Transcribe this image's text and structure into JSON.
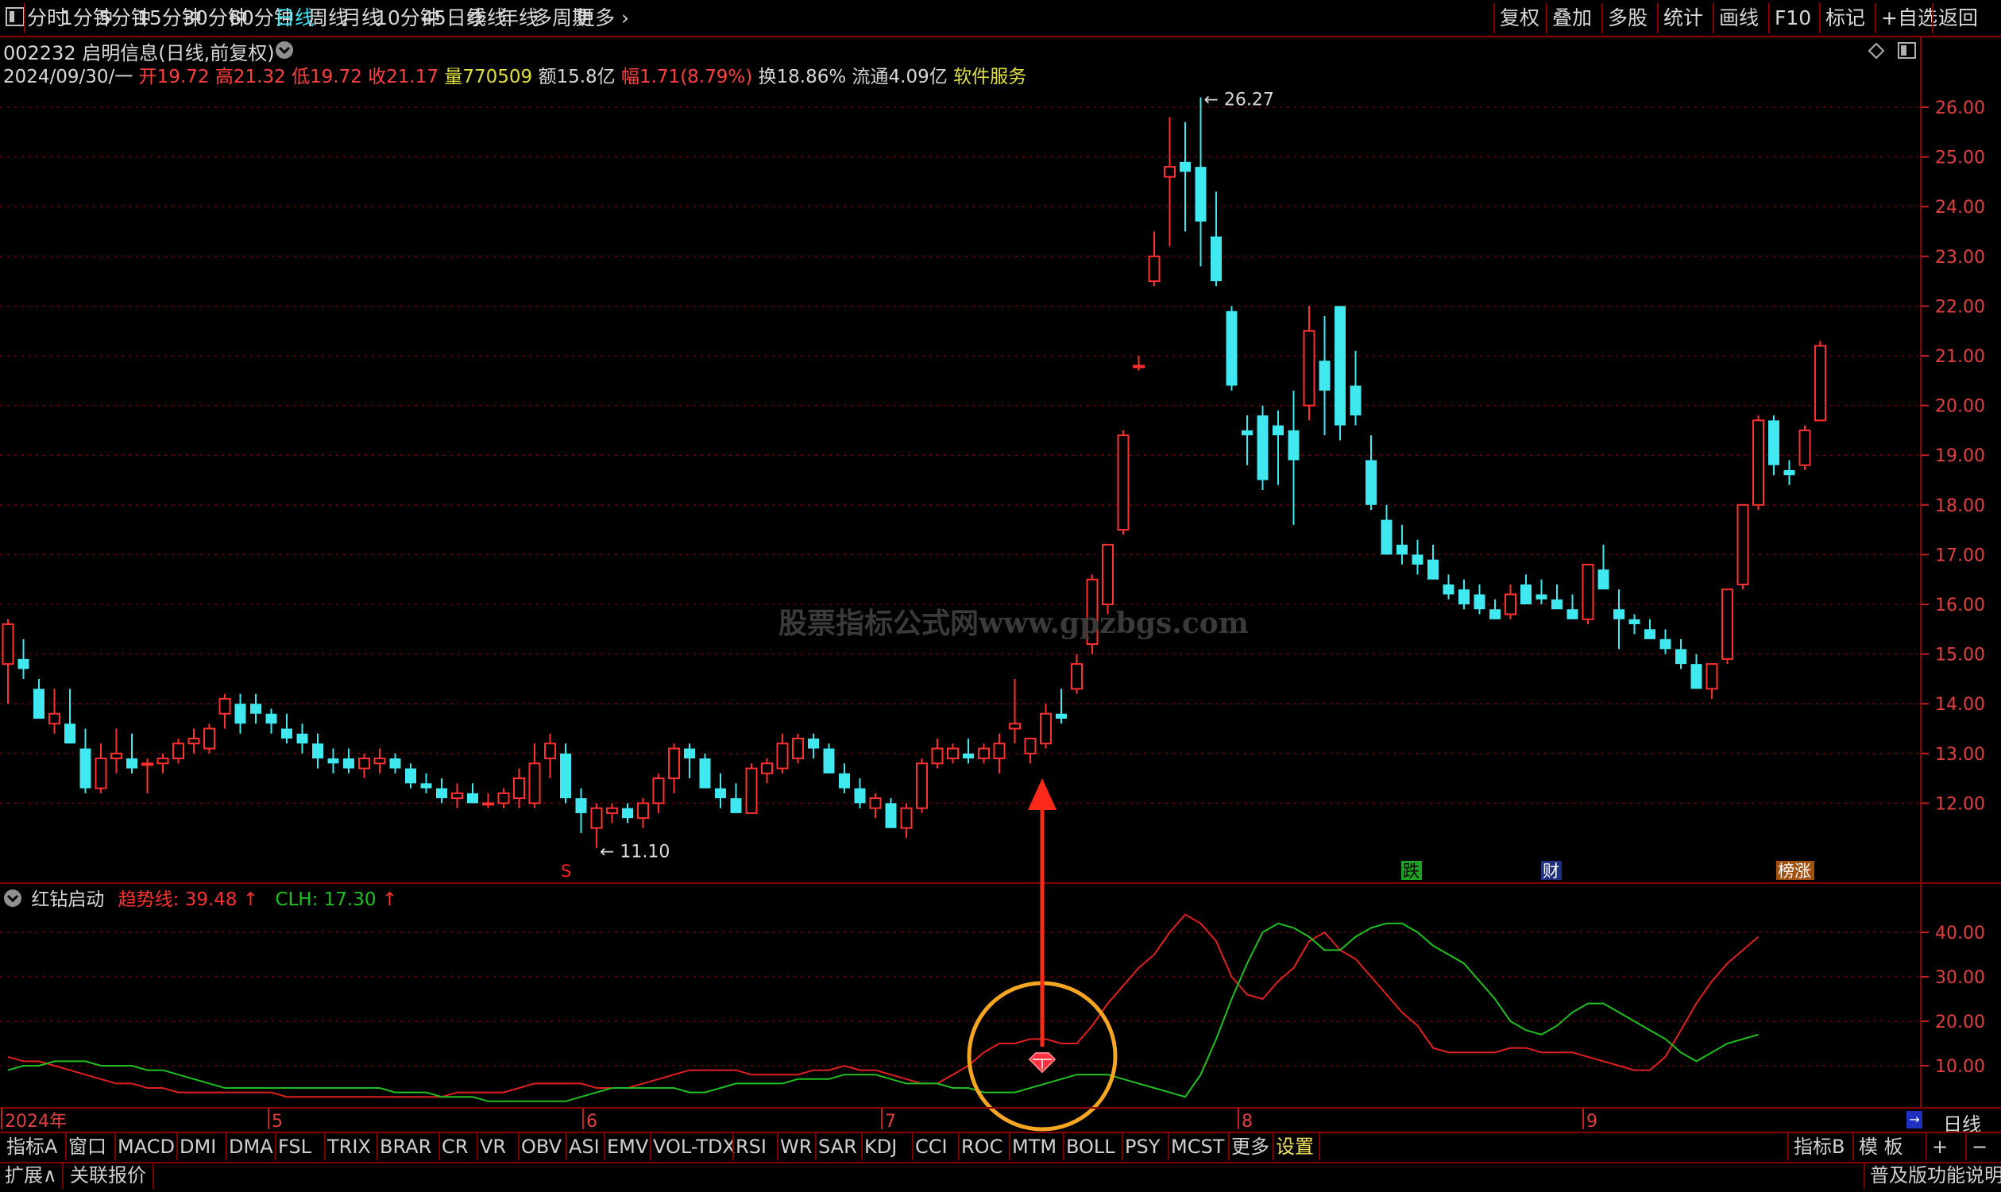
{
  "toolbar": {
    "tabs": [
      "分时",
      "1分钟",
      "5分钟",
      "15分钟",
      "30分钟",
      "60分钟",
      "日线",
      "周线",
      "月线",
      "10分钟",
      "45日线",
      "季线",
      "年线",
      "多周期",
      "更多"
    ],
    "active_tab": "日线",
    "right_buttons": [
      "复权",
      "叠加",
      "多股",
      "统计",
      "画线",
      "F10",
      "标记",
      "+自选",
      "返回"
    ]
  },
  "stock": {
    "code_name": "002232 启明信息(日线,前复权)",
    "date": "2024/09/30/一",
    "open": "开19.72",
    "high": "高21.32",
    "low": "低19.72",
    "close": "收21.17",
    "volume": "量770509",
    "amount": "额15.8亿",
    "change": "幅1.71(8.79%)",
    "turnover": "换18.86%",
    "float_mv": "流通4.09亿",
    "sector": "软件服务"
  },
  "watermark": "股票指标公式网www.gpzbgs.com",
  "price_axis": {
    "ticks": [
      "26.00",
      "25.00",
      "24.00",
      "23.00",
      "22.00",
      "21.00",
      "20.00",
      "19.00",
      "18.00",
      "17.00",
      "16.00",
      "15.00",
      "14.00",
      "13.00",
      "12.00"
    ],
    "high_label": "26.27",
    "low_label": "11.10"
  },
  "event_markers": {
    "s_marker": "S",
    "fall": "跌",
    "fin": "财",
    "rise": "榜涨"
  },
  "indicator": {
    "name": "红钻启动",
    "trend_label": "趋势线: 39.48",
    "clh_label": "CLH: 17.30",
    "ticks": [
      "40.00",
      "30.00",
      "20.00",
      "10.00"
    ],
    "trend_color": "#e02020",
    "clh_color": "#20c020"
  },
  "x_axis": {
    "labels": [
      "2024年",
      "5",
      "6",
      "7",
      "8",
      "9"
    ],
    "period": "日线"
  },
  "bottom_tabs": [
    "指标A",
    "窗口",
    "MACD",
    "DMI",
    "DMA",
    "FSL",
    "TRIX",
    "BRAR",
    "CR",
    "VR",
    "OBV",
    "ASI",
    "EMV",
    "VOL-TDX",
    "RSI",
    "WR",
    "SAR",
    "KDJ",
    "CCI",
    "ROC",
    "MTM",
    "BOLL",
    "PSY",
    "MCST",
    "更多",
    "设置"
  ],
  "bottom_right": [
    "指标B",
    "模 板",
    "+",
    "−"
  ],
  "status_bar": {
    "left": [
      "扩展∧",
      "关联报价"
    ],
    "right": "普及版功能说明"
  },
  "colors": {
    "up": "#ff3030",
    "down": "#40e8f0",
    "grid": "#7a0000",
    "axis_text": "#e04040",
    "annotation": "#f5a623",
    "arrow": "#ff2a1a"
  },
  "chart_data": {
    "type": "candlestick",
    "ylim": [
      11.0,
      26.5
    ],
    "candles": [
      [
        14.8,
        15.7,
        14.0,
        15.6
      ],
      [
        14.9,
        15.3,
        14.5,
        14.7
      ],
      [
        14.3,
        14.5,
        13.8,
        13.7
      ],
      [
        13.6,
        14.3,
        13.4,
        13.8
      ],
      [
        13.6,
        14.3,
        13.4,
        13.2
      ],
      [
        13.1,
        13.5,
        12.2,
        12.3
      ],
      [
        12.3,
        13.2,
        12.2,
        12.9
      ],
      [
        12.9,
        13.5,
        12.6,
        13.0
      ],
      [
        12.9,
        13.4,
        12.6,
        12.7
      ],
      [
        12.8,
        12.9,
        12.2,
        12.8
      ],
      [
        12.8,
        13.0,
        12.6,
        12.9
      ],
      [
        12.9,
        13.3,
        12.8,
        13.2
      ],
      [
        13.2,
        13.5,
        13.0,
        13.3
      ],
      [
        13.1,
        13.6,
        13.0,
        13.5
      ],
      [
        13.8,
        14.2,
        13.5,
        14.1
      ],
      [
        14.0,
        14.2,
        13.4,
        13.6
      ],
      [
        14.0,
        14.2,
        13.6,
        13.8
      ],
      [
        13.8,
        13.9,
        13.4,
        13.6
      ],
      [
        13.5,
        13.8,
        13.2,
        13.3
      ],
      [
        13.4,
        13.6,
        13.0,
        13.2
      ],
      [
        13.2,
        13.4,
        12.7,
        12.9
      ],
      [
        12.9,
        13.1,
        12.6,
        12.8
      ],
      [
        12.9,
        13.1,
        12.6,
        12.7
      ],
      [
        12.7,
        13.0,
        12.5,
        12.9
      ],
      [
        12.8,
        13.1,
        12.6,
        12.9
      ],
      [
        12.9,
        13.0,
        12.6,
        12.7
      ],
      [
        12.7,
        12.8,
        12.3,
        12.4
      ],
      [
        12.4,
        12.6,
        12.2,
        12.3
      ],
      [
        12.3,
        12.5,
        12.0,
        12.1
      ],
      [
        12.1,
        12.4,
        11.9,
        12.2
      ],
      [
        12.2,
        12.4,
        12.0,
        12.0
      ],
      [
        12.0,
        12.2,
        11.9,
        12.0
      ],
      [
        12.0,
        12.3,
        11.9,
        12.2
      ],
      [
        12.1,
        12.7,
        11.9,
        12.5
      ],
      [
        12.0,
        13.2,
        11.9,
        12.8
      ],
      [
        12.9,
        13.4,
        12.5,
        13.2
      ],
      [
        13.0,
        13.2,
        12.0,
        12.1
      ],
      [
        12.1,
        12.3,
        11.4,
        11.8
      ],
      [
        11.5,
        12.0,
        11.1,
        11.9
      ],
      [
        11.8,
        12.0,
        11.6,
        11.9
      ],
      [
        11.9,
        12.0,
        11.6,
        11.7
      ],
      [
        11.7,
        12.1,
        11.5,
        12.0
      ],
      [
        12.0,
        12.6,
        11.8,
        12.5
      ],
      [
        12.5,
        13.2,
        12.2,
        13.1
      ],
      [
        13.1,
        13.2,
        12.5,
        12.9
      ],
      [
        12.9,
        13.0,
        12.3,
        12.3
      ],
      [
        12.3,
        12.6,
        11.9,
        12.1
      ],
      [
        12.1,
        12.4,
        11.8,
        11.8
      ],
      [
        11.8,
        12.8,
        11.8,
        12.7
      ],
      [
        12.6,
        12.9,
        12.4,
        12.8
      ],
      [
        12.7,
        13.4,
        12.6,
        13.2
      ],
      [
        12.9,
        13.4,
        12.8,
        13.3
      ],
      [
        13.3,
        13.4,
        12.9,
        13.1
      ],
      [
        13.1,
        13.2,
        12.6,
        12.6
      ],
      [
        12.6,
        12.8,
        12.2,
        12.3
      ],
      [
        12.3,
        12.5,
        11.9,
        12.0
      ],
      [
        11.9,
        12.2,
        11.7,
        12.1
      ],
      [
        12.0,
        12.1,
        11.5,
        11.5
      ],
      [
        11.5,
        12.0,
        11.3,
        11.9
      ],
      [
        11.9,
        12.9,
        11.8,
        12.8
      ],
      [
        12.8,
        13.3,
        12.7,
        13.1
      ],
      [
        12.9,
        13.2,
        12.8,
        13.1
      ],
      [
        13.0,
        13.3,
        12.8,
        12.9
      ],
      [
        12.9,
        13.2,
        12.8,
        13.1
      ],
      [
        12.9,
        13.4,
        12.6,
        13.2
      ],
      [
        13.5,
        14.5,
        13.2,
        13.6
      ],
      [
        13.0,
        13.3,
        12.8,
        13.3
      ],
      [
        13.2,
        14.0,
        13.1,
        13.8
      ],
      [
        13.8,
        14.3,
        13.6,
        13.7
      ],
      [
        14.3,
        15.0,
        14.2,
        14.8
      ],
      [
        15.2,
        16.6,
        15.0,
        16.5
      ],
      [
        16.0,
        17.2,
        15.8,
        17.2
      ],
      [
        17.5,
        19.5,
        17.4,
        19.4
      ],
      [
        20.8,
        21.0,
        20.7,
        20.8
      ],
      [
        22.5,
        23.5,
        22.4,
        23.0
      ],
      [
        24.6,
        25.8,
        23.2,
        24.8
      ],
      [
        24.9,
        25.7,
        23.5,
        24.7
      ],
      [
        24.8,
        26.2,
        22.8,
        23.7
      ],
      [
        23.4,
        24.3,
        22.4,
        22.5
      ],
      [
        21.9,
        22.0,
        20.3,
        20.4
      ],
      [
        19.5,
        19.8,
        18.8,
        19.4
      ],
      [
        19.8,
        20.0,
        18.3,
        18.5
      ],
      [
        19.6,
        19.9,
        18.4,
        19.4
      ],
      [
        19.5,
        20.3,
        17.6,
        18.9
      ],
      [
        20.0,
        22.0,
        19.7,
        21.5
      ],
      [
        20.9,
        21.8,
        19.4,
        20.3
      ],
      [
        22.0,
        22.0,
        19.3,
        19.6
      ],
      [
        20.4,
        21.1,
        19.6,
        19.8
      ],
      [
        18.9,
        19.4,
        17.9,
        18.0
      ],
      [
        17.7,
        18.0,
        17.0,
        17.0
      ],
      [
        17.2,
        17.6,
        16.8,
        17.0
      ],
      [
        17.0,
        17.3,
        16.6,
        16.8
      ],
      [
        16.9,
        17.2,
        16.5,
        16.5
      ],
      [
        16.4,
        16.6,
        16.1,
        16.2
      ],
      [
        16.3,
        16.5,
        15.9,
        16.0
      ],
      [
        16.2,
        16.4,
        15.8,
        15.9
      ],
      [
        15.9,
        16.1,
        15.7,
        15.7
      ],
      [
        15.8,
        16.4,
        15.7,
        16.2
      ],
      [
        16.4,
        16.6,
        16.0,
        16.0
      ],
      [
        16.2,
        16.5,
        16.0,
        16.1
      ],
      [
        16.1,
        16.4,
        15.9,
        15.9
      ],
      [
        15.9,
        16.2,
        15.7,
        15.7
      ],
      [
        15.7,
        16.8,
        15.6,
        16.8
      ],
      [
        16.7,
        17.2,
        16.3,
        16.3
      ],
      [
        15.9,
        16.3,
        15.1,
        15.7
      ],
      [
        15.7,
        15.8,
        15.4,
        15.6
      ],
      [
        15.5,
        15.7,
        15.3,
        15.3
      ],
      [
        15.3,
        15.5,
        15.0,
        15.1
      ],
      [
        15.1,
        15.3,
        14.7,
        14.8
      ],
      [
        14.8,
        15.0,
        14.4,
        14.3
      ],
      [
        14.3,
        14.8,
        14.1,
        14.8
      ],
      [
        14.9,
        16.3,
        14.8,
        16.3
      ],
      [
        16.4,
        18.0,
        16.3,
        18.0
      ],
      [
        18.0,
        19.8,
        17.9,
        19.7
      ],
      [
        19.7,
        19.8,
        18.6,
        18.8
      ],
      [
        18.7,
        18.9,
        18.4,
        18.6
      ],
      [
        18.8,
        19.6,
        18.7,
        19.5
      ],
      [
        19.7,
        21.3,
        19.7,
        21.2
      ]
    ],
    "indicator_series": [
      {
        "name": "趋势线",
        "color": "#e02020",
        "values": [
          12,
          11,
          11,
          10,
          9,
          8,
          7,
          6,
          6,
          5,
          5,
          4,
          4,
          4,
          4,
          4,
          4,
          4,
          3,
          3,
          3,
          3,
          3,
          3,
          3,
          3,
          3,
          3,
          3,
          4,
          4,
          4,
          4,
          5,
          6,
          6,
          6,
          6,
          5,
          5,
          5,
          6,
          7,
          8,
          9,
          9,
          9,
          9,
          8,
          8,
          8,
          8,
          9,
          9,
          10,
          9,
          9,
          8,
          7,
          6,
          6,
          8,
          10,
          13,
          15,
          15,
          16,
          16,
          15,
          15,
          19,
          24,
          28,
          32,
          35,
          40,
          44,
          42,
          38,
          30,
          26,
          25,
          29,
          32,
          38,
          40,
          36,
          34,
          30,
          26,
          22,
          19,
          14,
          13,
          13,
          13,
          13,
          14,
          14,
          13,
          13,
          13,
          12,
          11,
          10,
          9,
          9,
          12,
          18,
          24,
          29,
          33,
          36,
          39
        ]
      },
      {
        "name": "CLH",
        "color": "#20c020",
        "values": [
          9,
          10,
          10,
          11,
          11,
          11,
          10,
          10,
          10,
          9,
          9,
          8,
          7,
          6,
          5,
          5,
          5,
          5,
          5,
          5,
          5,
          5,
          5,
          5,
          5,
          4,
          4,
          4,
          3,
          3,
          3,
          2,
          2,
          2,
          2,
          2,
          2,
          3,
          4,
          5,
          5,
          5,
          5,
          5,
          4,
          4,
          5,
          6,
          6,
          6,
          6,
          7,
          7,
          7,
          8,
          8,
          8,
          7,
          6,
          6,
          6,
          5,
          5,
          4,
          4,
          4,
          5,
          6,
          7,
          8,
          8,
          8,
          7,
          6,
          5,
          4,
          3,
          8,
          16,
          25,
          33,
          40,
          42,
          41,
          39,
          36,
          36,
          39,
          41,
          42,
          42,
          40,
          37,
          35,
          33,
          29,
          25,
          20,
          18,
          17,
          19,
          22,
          24,
          24,
          22,
          20,
          18,
          16,
          13,
          11,
          13,
          15,
          16,
          17
        ]
      }
    ]
  }
}
